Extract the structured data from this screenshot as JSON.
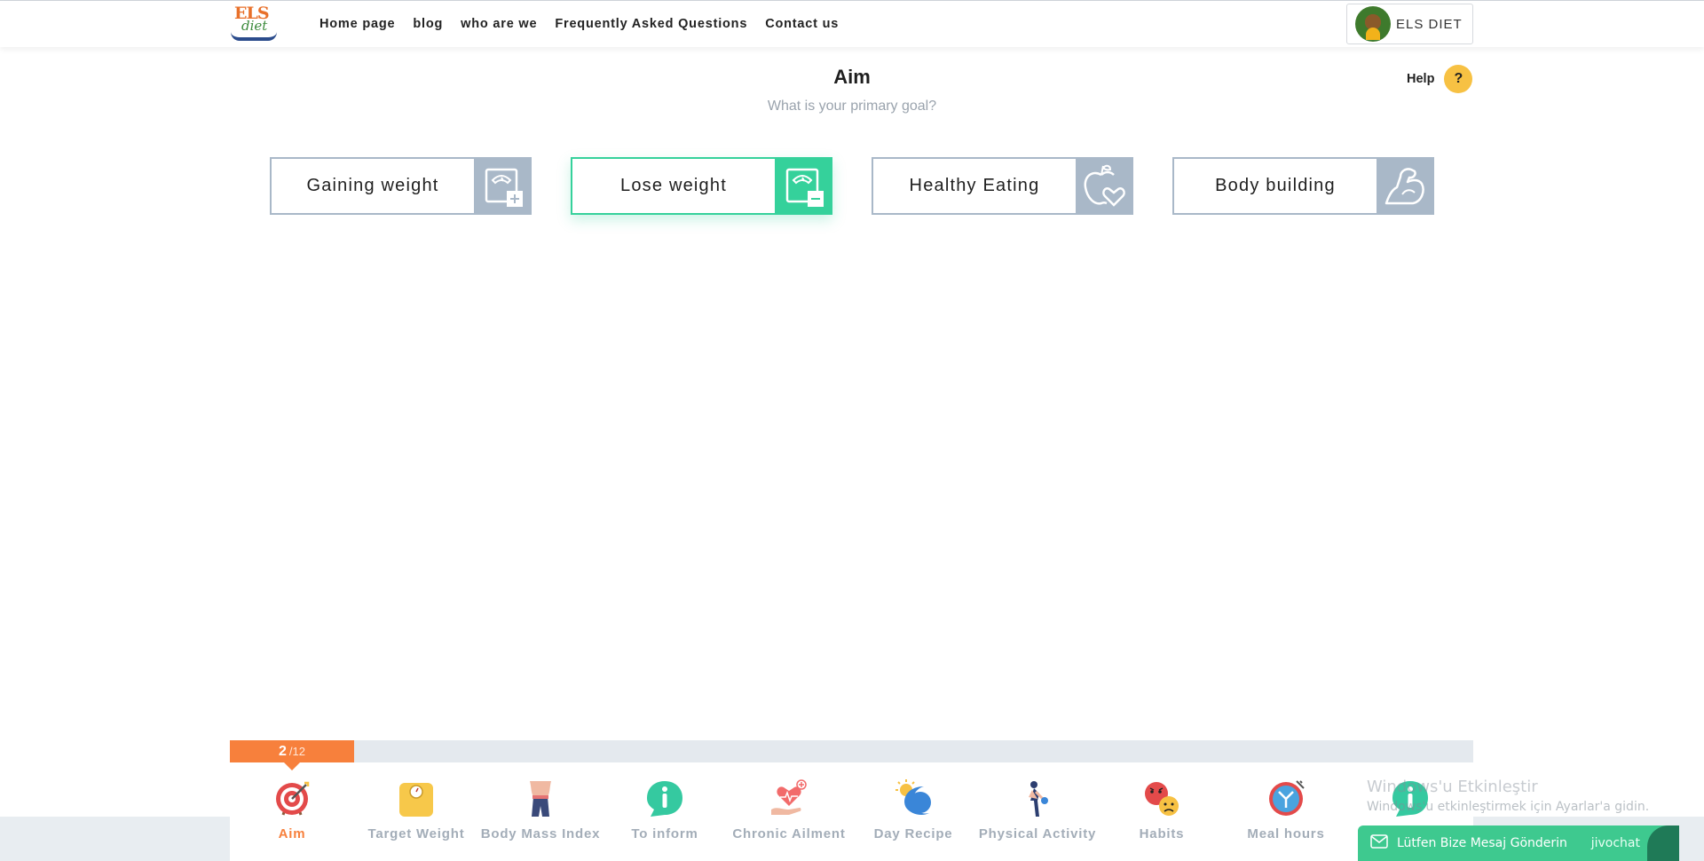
{
  "brand": {
    "logo_line1": "ELS",
    "logo_line2": "diet"
  },
  "nav": {
    "items": [
      "Home page",
      "blog",
      "who are we",
      "Frequently Asked Questions",
      "Contact us"
    ]
  },
  "account": {
    "name": "ELS DIET"
  },
  "header": {
    "title": "Aim",
    "subtitle": "What is your primary goal?",
    "help_label": "Help",
    "help_icon_glyph": "?"
  },
  "goals": [
    {
      "label": "Gaining weight",
      "icon": "scale-plus-icon",
      "selected": false
    },
    {
      "label": "Lose weight",
      "icon": "scale-minus-icon",
      "selected": true
    },
    {
      "label": "Healthy Eating",
      "icon": "apple-heart-icon",
      "selected": false
    },
    {
      "label": "Body building",
      "icon": "flexed-arm-icon",
      "selected": false
    }
  ],
  "progress": {
    "current": "2",
    "total": "/12",
    "fraction": 0.1667
  },
  "steps": [
    {
      "label": "Aim",
      "icon": "target-icon",
      "active": true
    },
    {
      "label": "Target Weight",
      "icon": "bathroom-scale-icon",
      "active": false
    },
    {
      "label": "Body Mass Index",
      "icon": "body-waist-icon",
      "active": false
    },
    {
      "label": "To inform",
      "icon": "info-bubble-icon",
      "active": false
    },
    {
      "label": "Chronic Ailment",
      "icon": "heart-hand-icon",
      "active": false
    },
    {
      "label": "Day Recipe",
      "icon": "sun-moon-icon",
      "active": false
    },
    {
      "label": "Physical Activity",
      "icon": "exercise-person-icon",
      "active": false
    },
    {
      "label": "Habits",
      "icon": "emoji-faces-icon",
      "active": false
    },
    {
      "label": "Meal hours",
      "icon": "clock-cutlery-icon",
      "active": false
    },
    {
      "label": "",
      "icon": "info-bubble-icon",
      "active": false
    }
  ],
  "watermark": {
    "line1": "Windows'u Etkinleştir",
    "line2": "Windows'u etkinleştirmek için Ayarlar'a gidin."
  },
  "chat": {
    "text": "Lütfen Bize Mesaj Gönderin",
    "brand": "jivochat"
  },
  "colors": {
    "accent_green": "#35d19b",
    "accent_orange": "#f7803c",
    "card_gray": "#a9b8c8",
    "help_yellow": "#f7c143",
    "chat_green": "#3ec98f"
  }
}
